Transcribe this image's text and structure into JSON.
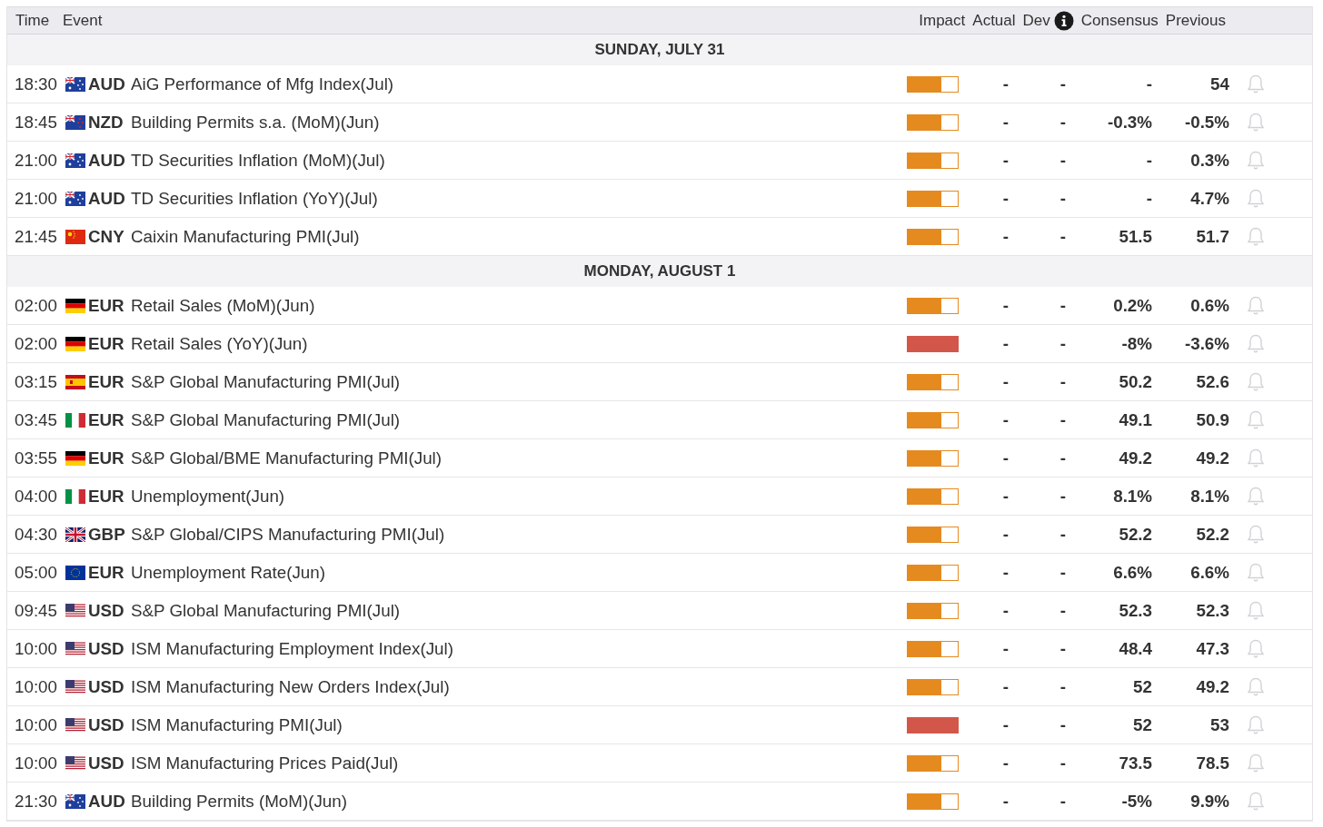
{
  "columns": {
    "time": "Time",
    "event": "Event",
    "impact": "Impact",
    "actual": "Actual",
    "dev": "Dev",
    "consensus": "Consensus",
    "previous": "Previous"
  },
  "days": [
    {
      "date": "SUNDAY, JULY 31",
      "events": [
        {
          "time": "18:30",
          "kind": "au",
          "currency": "AUD",
          "event": "AiG Performance of Mfg Index(Jul)",
          "level": 0.67,
          "actual": "-",
          "dev": "-",
          "consensus": "-",
          "previous": "54"
        },
        {
          "time": "18:45",
          "kind": "nz",
          "currency": "NZD",
          "event": "Building Permits s.a. (MoM)(Jun)",
          "level": 0.67,
          "actual": "-",
          "dev": "-",
          "consensus": "-0.3%",
          "previous": "-0.5%"
        },
        {
          "time": "21:00",
          "kind": "au",
          "currency": "AUD",
          "event": "TD Securities Inflation (MoM)(Jul)",
          "level": 0.67,
          "actual": "-",
          "dev": "-",
          "consensus": "-",
          "previous": "0.3%"
        },
        {
          "time": "21:00",
          "kind": "au",
          "currency": "AUD",
          "event": "TD Securities Inflation (YoY)(Jul)",
          "level": 0.67,
          "actual": "-",
          "dev": "-",
          "consensus": "-",
          "previous": "4.7%"
        },
        {
          "time": "21:45",
          "kind": "cn",
          "currency": "CNY",
          "event": "Caixin Manufacturing PMI(Jul)",
          "level": 0.67,
          "actual": "-",
          "dev": "-",
          "consensus": "51.5",
          "previous": "51.7"
        }
      ]
    },
    {
      "date": "MONDAY, AUGUST 1",
      "events": [
        {
          "time": "02:00",
          "kind": "de",
          "currency": "EUR",
          "event": "Retail Sales (MoM)(Jun)",
          "level": 0.67,
          "actual": "-",
          "dev": "-",
          "consensus": "0.2%",
          "previous": "0.6%"
        },
        {
          "time": "02:00",
          "kind": "de",
          "currency": "EUR",
          "event": "Retail Sales (YoY)(Jun)",
          "level": 1,
          "actual": "-",
          "dev": "-",
          "consensus": "-8%",
          "previous": "-3.6%"
        },
        {
          "time": "03:15",
          "kind": "es",
          "currency": "EUR",
          "event": "S&P Global Manufacturing PMI(Jul)",
          "level": 0.67,
          "actual": "-",
          "dev": "-",
          "consensus": "50.2",
          "previous": "52.6"
        },
        {
          "time": "03:45",
          "kind": "it",
          "currency": "EUR",
          "event": "S&P Global Manufacturing PMI(Jul)",
          "level": 0.67,
          "actual": "-",
          "dev": "-",
          "consensus": "49.1",
          "previous": "50.9"
        },
        {
          "time": "03:55",
          "kind": "de",
          "currency": "EUR",
          "event": "S&P Global/BME Manufacturing PMI(Jul)",
          "level": 0.67,
          "actual": "-",
          "dev": "-",
          "consensus": "49.2",
          "previous": "49.2"
        },
        {
          "time": "04:00",
          "kind": "it",
          "currency": "EUR",
          "event": "Unemployment(Jun)",
          "level": 0.67,
          "actual": "-",
          "dev": "-",
          "consensus": "8.1%",
          "previous": "8.1%"
        },
        {
          "time": "04:30",
          "kind": "gb",
          "currency": "GBP",
          "event": "S&P Global/CIPS Manufacturing PMI(Jul)",
          "level": 0.67,
          "actual": "-",
          "dev": "-",
          "consensus": "52.2",
          "previous": "52.2"
        },
        {
          "time": "05:00",
          "kind": "eu",
          "currency": "EUR",
          "event": "Unemployment Rate(Jun)",
          "level": 0.67,
          "actual": "-",
          "dev": "-",
          "consensus": "6.6%",
          "previous": "6.6%"
        },
        {
          "time": "09:45",
          "kind": "us",
          "currency": "USD",
          "event": "S&P Global Manufacturing PMI(Jul)",
          "level": 0.67,
          "actual": "-",
          "dev": "-",
          "consensus": "52.3",
          "previous": "52.3"
        },
        {
          "time": "10:00",
          "kind": "us",
          "currency": "USD",
          "event": "ISM Manufacturing Employment Index(Jul)",
          "level": 0.67,
          "actual": "-",
          "dev": "-",
          "consensus": "48.4",
          "previous": "47.3"
        },
        {
          "time": "10:00",
          "kind": "us",
          "currency": "USD",
          "event": "ISM Manufacturing New Orders Index(Jul)",
          "level": 0.67,
          "actual": "-",
          "dev": "-",
          "consensus": "52",
          "previous": "49.2"
        },
        {
          "time": "10:00",
          "kind": "us",
          "currency": "USD",
          "event": "ISM Manufacturing PMI(Jul)",
          "level": 1,
          "actual": "-",
          "dev": "-",
          "consensus": "52",
          "previous": "53"
        },
        {
          "time": "10:00",
          "kind": "us",
          "currency": "USD",
          "event": "ISM Manufacturing Prices Paid(Jul)",
          "level": 0.67,
          "actual": "-",
          "dev": "-",
          "consensus": "73.5",
          "previous": "78.5"
        },
        {
          "time": "21:30",
          "kind": "au",
          "currency": "AUD",
          "event": "Building Permits (MoM)(Jun)",
          "level": 0.67,
          "actual": "-",
          "dev": "-",
          "consensus": "-5%",
          "previous": "9.9%"
        }
      ]
    }
  ]
}
